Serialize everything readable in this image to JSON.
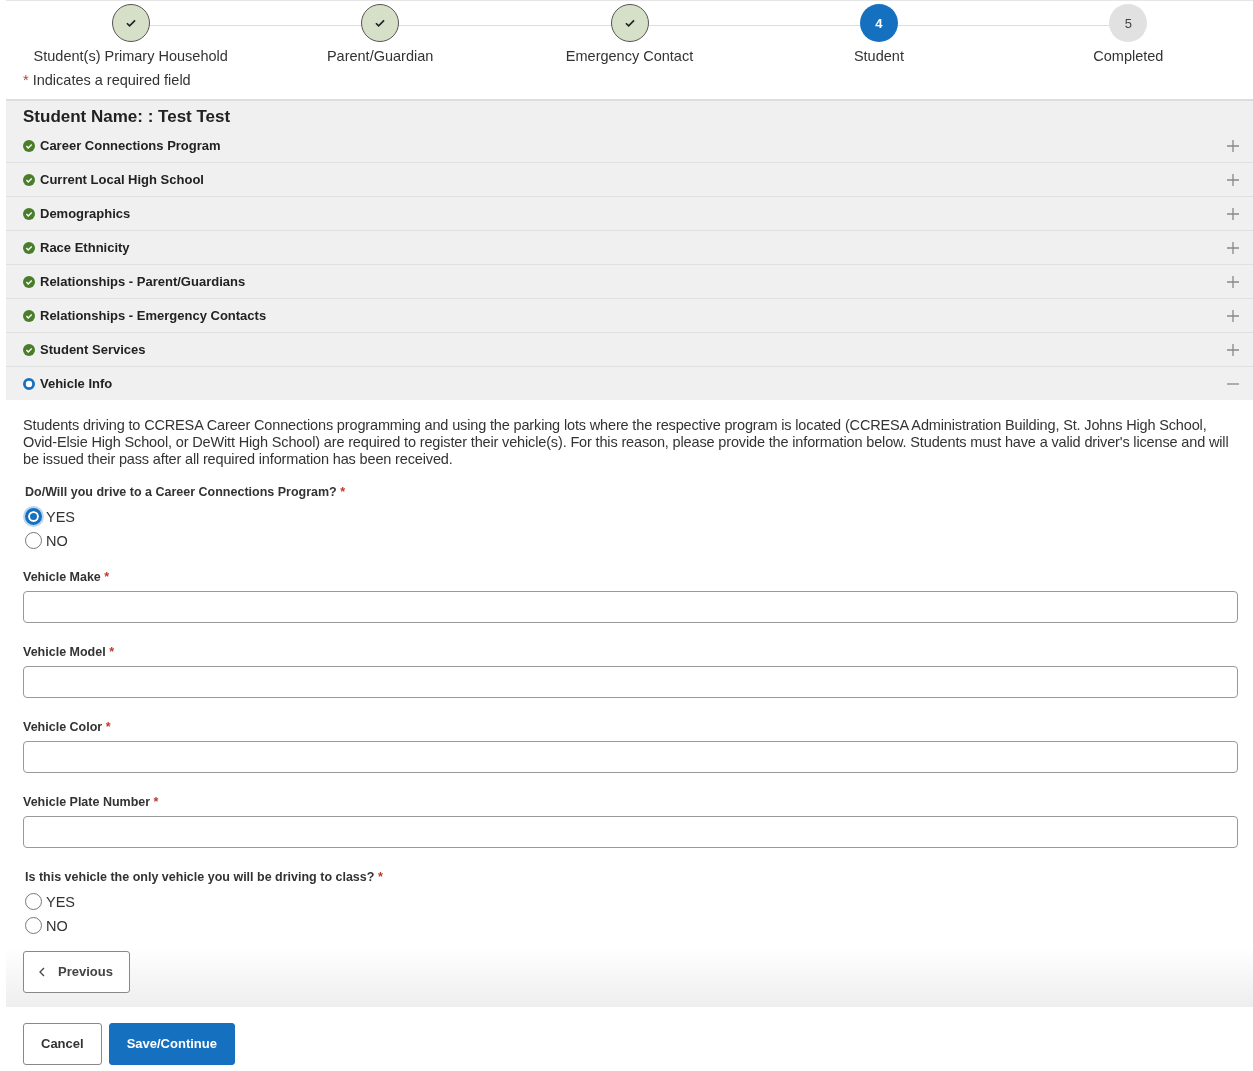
{
  "steps": [
    {
      "label": "Student(s) Primary Household",
      "done": true,
      "selected": false
    },
    {
      "label": "Parent/Guardian",
      "done": true,
      "selected": false
    },
    {
      "label": "Emergency Contact",
      "done": true,
      "selected": false
    },
    {
      "label": "Student",
      "done": false,
      "selected": true,
      "number": "4"
    },
    {
      "label": "Completed",
      "done": false,
      "selected": false,
      "number": "5"
    }
  ],
  "required_note": {
    "mark": "*",
    "text": "Indicates a required field"
  },
  "panel": {
    "title": "Student Name: : Test Test",
    "sections": [
      {
        "label": "Career Connections Program",
        "complete": true,
        "expanded": false
      },
      {
        "label": "Current Local High School",
        "complete": true,
        "expanded": false
      },
      {
        "label": "Demographics",
        "complete": true,
        "expanded": false
      },
      {
        "label": "Race Ethnicity",
        "complete": true,
        "expanded": false
      },
      {
        "label": "Relationships - Parent/Guardians",
        "complete": true,
        "expanded": false
      },
      {
        "label": "Relationships - Emergency Contacts",
        "complete": true,
        "expanded": false
      },
      {
        "label": "Student Services",
        "complete": true,
        "expanded": false
      },
      {
        "label": "Vehicle Info",
        "complete": false,
        "expanded": true
      }
    ]
  },
  "description": "Students driving to CCRESA Career Connections programming and using the parking lots where the respective program is located (CCRESA Administration Building, St. Johns High School, Ovid-Elsie High School, or DeWitt High School) are required to register their vehicle(s). For this reason, please provide the information below. Students must have a valid driver's license and will be issued their pass after all required information has been received.",
  "fields": [
    {
      "kind": "radio",
      "label": "Do/Will you drive to a Career Connections Program?",
      "mark": "*",
      "options": [
        {
          "label": "YES",
          "selected": true
        },
        {
          "label": "NO",
          "selected": false
        }
      ]
    },
    {
      "kind": "text",
      "label": "Vehicle Make",
      "mark": "*"
    },
    {
      "kind": "text",
      "label": "Vehicle Model",
      "mark": "*"
    },
    {
      "kind": "text",
      "label": "Vehicle Color",
      "mark": "*"
    },
    {
      "kind": "text",
      "label": "Vehicle Plate Number",
      "mark": "*"
    },
    {
      "kind": "radio",
      "label": "Is this vehicle the only vehicle you will be driving to class?",
      "mark": "*",
      "options": [
        {
          "label": "YES",
          "selected": false
        },
        {
          "label": "NO",
          "selected": false
        }
      ]
    }
  ],
  "previous_button": "Previous",
  "buttons": [
    {
      "label": "Cancel",
      "kind": "secondary"
    },
    {
      "label": "Save/Continue",
      "kind": "primary"
    }
  ]
}
